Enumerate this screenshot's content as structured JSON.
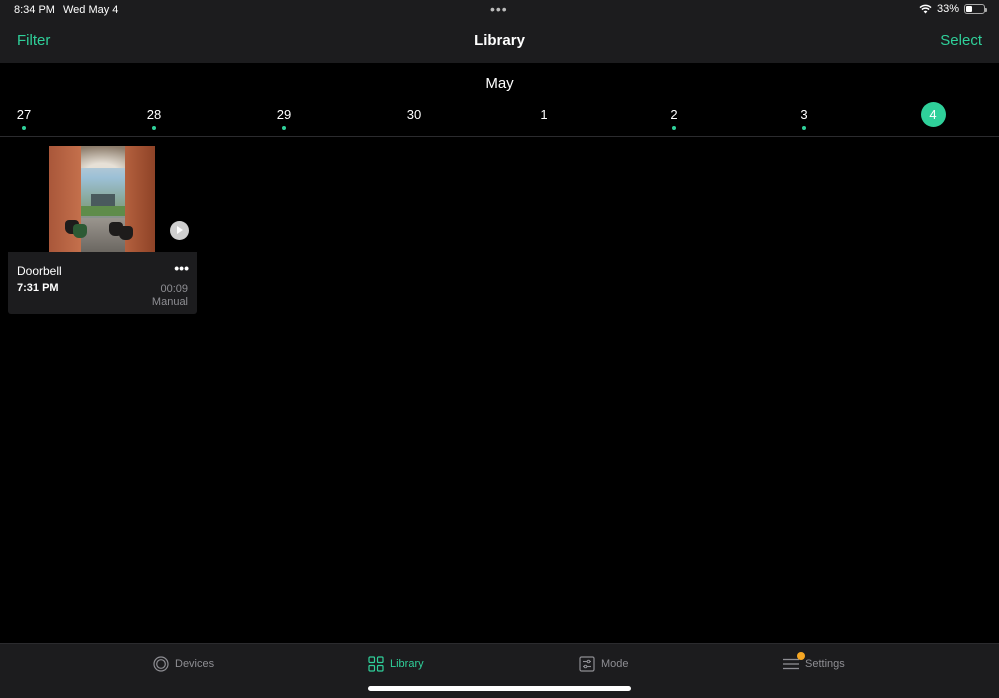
{
  "status_bar": {
    "time": "8:34 PM",
    "date": "Wed May 4",
    "more": "•••",
    "battery_percent": "33%",
    "battery_level": 0.33
  },
  "nav": {
    "filter_label": "Filter",
    "title": "Library",
    "select_label": "Select"
  },
  "calendar": {
    "month": "May",
    "dates": [
      {
        "day": "27",
        "has_events": true,
        "selected": false
      },
      {
        "day": "28",
        "has_events": true,
        "selected": false
      },
      {
        "day": "29",
        "has_events": true,
        "selected": false
      },
      {
        "day": "30",
        "has_events": false,
        "selected": false
      },
      {
        "day": "1",
        "has_events": false,
        "selected": false
      },
      {
        "day": "2",
        "has_events": true,
        "selected": false
      },
      {
        "day": "3",
        "has_events": true,
        "selected": false
      },
      {
        "day": "4",
        "has_events": false,
        "selected": true
      }
    ]
  },
  "events": [
    {
      "device": "Doorbell",
      "time": "7:31 PM",
      "duration": "00:09",
      "trigger": "Manual",
      "more": "•••"
    }
  ],
  "tabs": [
    {
      "label": "Devices",
      "icon": "devices-icon",
      "active": false
    },
    {
      "label": "Library",
      "icon": "library-grid-icon",
      "active": true
    },
    {
      "label": "Mode",
      "icon": "mode-sliders-icon",
      "active": false
    },
    {
      "label": "Settings",
      "icon": "settings-menu-icon",
      "active": false,
      "badge": true
    }
  ],
  "colors": {
    "accent": "#2fd09a",
    "background": "#000000",
    "bar": "#1c1c1e",
    "secondary_text": "#8e8e93",
    "badge": "#f5a623"
  }
}
